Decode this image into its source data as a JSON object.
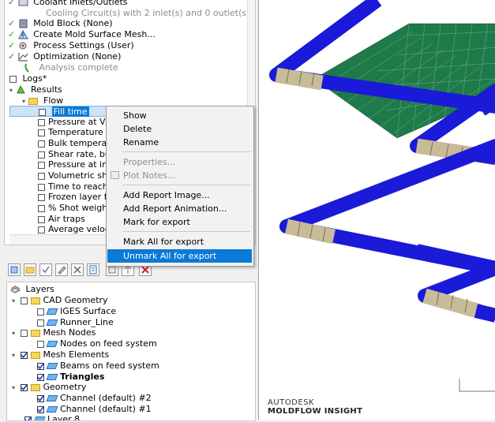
{
  "tree": {
    "items": [
      {
        "label": "Coolant Inlets/Outlets",
        "kind": "ok"
      },
      {
        "label": "Cooling Circuit(s) with 2 inlet(s) and 0 outlet(s)",
        "kind": "sub"
      },
      {
        "label": "Mold Block (None)",
        "kind": "ok"
      },
      {
        "label": "Create Mold Surface Mesh...",
        "kind": "ok"
      },
      {
        "label": "Process Settings (User)",
        "kind": "ok"
      },
      {
        "label": "Optimization (None)",
        "kind": "ok"
      },
      {
        "label": "Analysis complete",
        "kind": "status"
      },
      {
        "label": "Logs*",
        "kind": "plain"
      },
      {
        "label": "Results",
        "kind": "results"
      },
      {
        "label": "Flow",
        "kind": "folder"
      },
      {
        "label": "Fill time",
        "kind": "result-selected"
      },
      {
        "label": "Pressure at V/",
        "kind": "result"
      },
      {
        "label": "Temperature a",
        "kind": "result"
      },
      {
        "label": "Bulk temperati",
        "kind": "result"
      },
      {
        "label": "Shear rate, bu",
        "kind": "result"
      },
      {
        "label": "Pressure at in",
        "kind": "result"
      },
      {
        "label": "Volumetric shi",
        "kind": "result"
      },
      {
        "label": "Time to reach",
        "kind": "result"
      },
      {
        "label": "Frozen layer fr",
        "kind": "result"
      },
      {
        "label": "% Shot weight",
        "kind": "result"
      },
      {
        "label": "Air traps",
        "kind": "result"
      },
      {
        "label": "Average veloc",
        "kind": "result"
      }
    ]
  },
  "context_menu": {
    "items": [
      {
        "label": "Show",
        "state": "normal"
      },
      {
        "label": "Delete",
        "state": "normal"
      },
      {
        "label": "Rename",
        "state": "normal"
      },
      {
        "label": "Properties...",
        "state": "disabled"
      },
      {
        "label": "Plot Notes...",
        "state": "disabled"
      },
      {
        "label": "Add Report Image...",
        "state": "normal"
      },
      {
        "label": "Add Report Animation...",
        "state": "normal"
      },
      {
        "label": "Mark for export",
        "state": "normal"
      },
      {
        "label": "Mark All for export",
        "state": "normal"
      },
      {
        "label": "Unmark All for export",
        "state": "highlighted"
      }
    ]
  },
  "layers": {
    "title": "Layers",
    "items": [
      {
        "label": "CAD Geometry",
        "level": 0,
        "checked": false,
        "type": "folder"
      },
      {
        "label": "IGES Surface",
        "level": 1,
        "checked": false,
        "type": "layer"
      },
      {
        "label": "Runner_Line",
        "level": 1,
        "checked": false,
        "type": "layer"
      },
      {
        "label": "Mesh Nodes",
        "level": 0,
        "checked": false,
        "type": "folder"
      },
      {
        "label": "Nodes on feed system",
        "level": 1,
        "checked": false,
        "type": "layer"
      },
      {
        "label": "Mesh Elements",
        "level": 0,
        "checked": true,
        "type": "folder"
      },
      {
        "label": "Beams on feed system",
        "level": 1,
        "checked": true,
        "type": "layer"
      },
      {
        "label": "Triangles",
        "level": 1,
        "checked": true,
        "type": "layer",
        "bold": true
      },
      {
        "label": "Geometry",
        "level": 0,
        "checked": true,
        "type": "folder"
      },
      {
        "label": "Channel (default) #2",
        "level": 1,
        "checked": true,
        "type": "layer"
      },
      {
        "label": "Channel (default) #1",
        "level": 1,
        "checked": true,
        "type": "layer"
      },
      {
        "label": "Layer 8",
        "level": 0,
        "checked": true,
        "type": "layer"
      }
    ]
  },
  "branding": {
    "line1": "AUTODESK",
    "line2": "MOLDFLOW",
    "line3": "INSIGHT"
  },
  "colors": {
    "selection": "#0b7ad6",
    "beam_blue": "#1a1ad8",
    "pipe_tan": "#c8bc98",
    "mesh_green": "#1f7a4a"
  }
}
